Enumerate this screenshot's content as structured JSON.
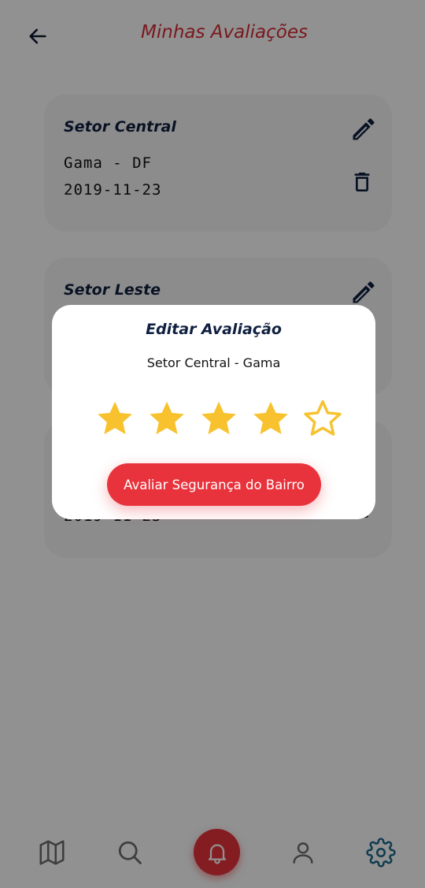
{
  "header": {
    "title": "Minhas Avaliações"
  },
  "cards": [
    {
      "title": "Setor Central",
      "city": "Gama - DF",
      "date": "2019-11-23"
    },
    {
      "title": "Setor Leste",
      "city": "",
      "date": ""
    },
    {
      "title": "",
      "city": "",
      "date": "2019-11-23"
    }
  ],
  "modal": {
    "title": "Editar Avaliação",
    "subtitle": "Setor Central - Gama",
    "rating": 4,
    "max_rating": 5,
    "submit_label": "Avaliar Segurança do Bairro"
  },
  "icons": {
    "back": "arrow-left-icon",
    "edit": "pencil-icon",
    "delete": "trash-icon",
    "star_filled": "star-filled-icon",
    "star_empty": "star-outline-icon",
    "nav_map": "map-icon",
    "nav_search": "search-icon",
    "nav_alert": "bell-icon",
    "nav_profile": "user-icon",
    "nav_settings": "gear-icon"
  },
  "colors": {
    "accent": "#e8333c",
    "title_red": "#d72b34",
    "navy": "#102040",
    "star": "#f7c22e",
    "settings_active": "#1c6a8c"
  }
}
